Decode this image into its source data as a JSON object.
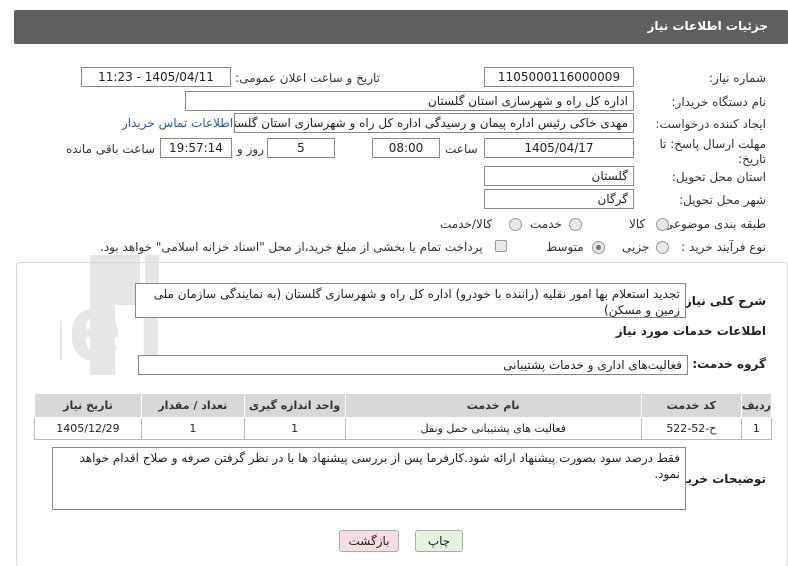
{
  "header": {
    "title": "جزئیات اطلاعات نیاز"
  },
  "fields": {
    "need_number_label": "شماره نیاز:",
    "need_number": "1105000116000009",
    "announce_label": "تاریخ و ساعت اعلان عمومی:",
    "announce_value": "1405/04/11 - 11:23",
    "buyer_org_label": "نام دستگاه خریدار:",
    "buyer_org": "اداره کل راه و شهرسازی استان گلستان",
    "requester_label": "ایجاد کننده درخواست:",
    "requester": "مهدی خاکی رئیس اداره پیمان و رسیدگی اداره کل راه و شهرسازی استان گلستان",
    "contact_link": "اطلاعات تماس خریدار",
    "deadline_label": "مهلت ارسال پاسخ: تا تاریخ:",
    "deadline_date": "1405/04/17",
    "time_label": "ساعت",
    "deadline_time": "08:00",
    "days_value": "5",
    "days_label": "روز و",
    "remaining_time": "19:57:14",
    "remaining_label": "ساعت باقی مانده",
    "province_label": "استان محل تحویل:",
    "province": "گلستان",
    "city_label": "شهر محل تحویل:",
    "city": "گرگان",
    "category_label": "طبقه بندی موضوعی:",
    "category_options": [
      "کالا",
      "خدمت",
      "کالا/خدمت"
    ],
    "purchase_type_label": "نوع فرآیند خرید :",
    "purchase_options": [
      "جزیی",
      "متوسط"
    ],
    "payment_note": "پرداخت تمام یا بخشی از مبلغ خرید،از محل \"اسناد خزانه اسلامی\" خواهد بود."
  },
  "summary": {
    "label": "شرح کلی نیاز:",
    "text": "تجدید استعلام بها  امور نقلیه (راننده با خودرو) اداره کل راه و شهرسازی گلستان (به نمایندگی سازمان ملی زمین و مسکن)"
  },
  "services_section": {
    "title": "اطلاعات خدمات مورد نیاز",
    "group_label": "گروه خدمت:",
    "group_value": "فعالیت‌های اداری و خدمات پشتیبانی"
  },
  "table": {
    "headers": [
      "ردیف",
      "کد خدمت",
      "نام خدمت",
      "واحد اندازه گیری",
      "تعداد / مقدار",
      "تاریخ نیاز"
    ],
    "rows": [
      [
        "1",
        "ح-52-522",
        "فعالیت های پشتیبانی حمل ونقل",
        "1",
        "1",
        "1405/12/29"
      ]
    ]
  },
  "buyer_notes": {
    "label": "توضیحات خریدار:",
    "text": "فقط  درصد سود بصورت پیشنهاد ارائه شود.کارفرما پس از بررسی پیشنهاد ها با در نظر گرفتن صرفه و صلاح اقدام خواهد نمود."
  },
  "buttons": {
    "print": "چاپ",
    "back": "بازگشت"
  },
  "watermark": {
    "text": "AriaTender.neT"
  },
  "colors": {
    "header_bg": "#5f5f5f",
    "link": "#1a5fb4",
    "back_button_bg": "#f7dede",
    "print_button_bg": "#e4f3dc"
  }
}
